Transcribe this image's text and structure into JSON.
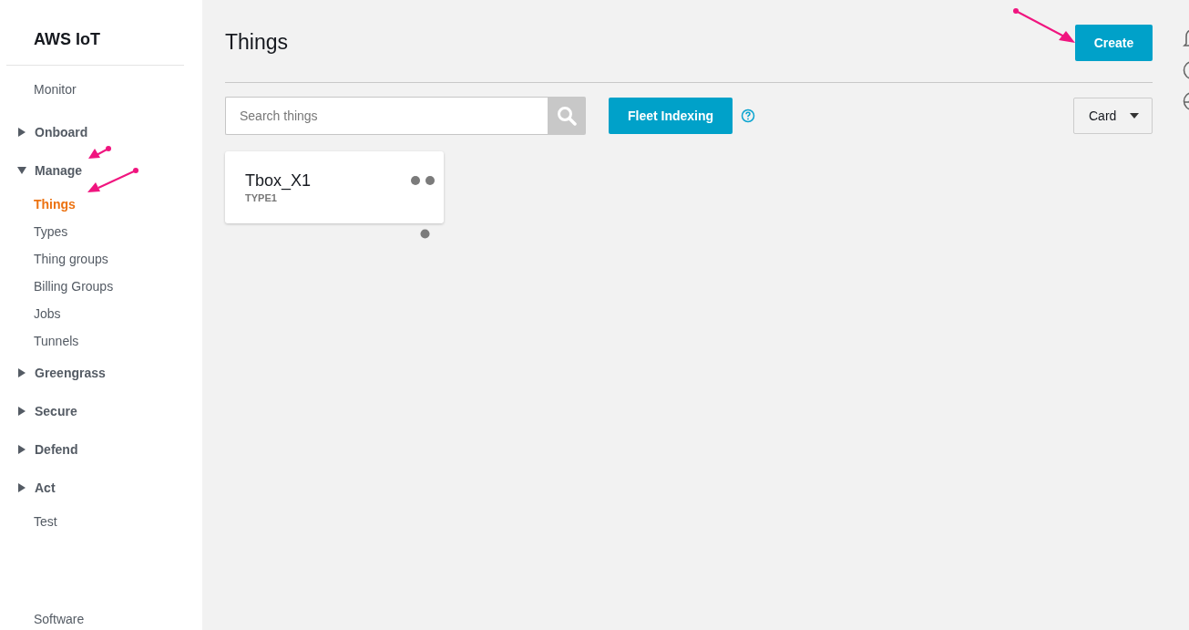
{
  "sidebar": {
    "title": "AWS IoT",
    "items": [
      {
        "kind": "link",
        "label": "Monitor",
        "selected": false
      },
      {
        "kind": "group",
        "label": "Onboard",
        "expanded": false
      },
      {
        "kind": "group",
        "label": "Manage",
        "expanded": true,
        "children": [
          {
            "label": "Things",
            "selected": true
          },
          {
            "label": "Types",
            "selected": false
          },
          {
            "label": "Thing groups",
            "selected": false
          },
          {
            "label": "Billing Groups",
            "selected": false
          },
          {
            "label": "Jobs",
            "selected": false
          },
          {
            "label": "Tunnels",
            "selected": false
          }
        ]
      },
      {
        "kind": "group",
        "label": "Greengrass",
        "expanded": false
      },
      {
        "kind": "group",
        "label": "Secure",
        "expanded": false
      },
      {
        "kind": "group",
        "label": "Defend",
        "expanded": false
      },
      {
        "kind": "group",
        "label": "Act",
        "expanded": false
      },
      {
        "kind": "link",
        "label": "Test",
        "selected": false
      }
    ],
    "footer": "Software"
  },
  "page": {
    "title": "Things",
    "create_button": "Create"
  },
  "toolbar": {
    "search": {
      "placeholder": "Search things"
    },
    "fleet_button": "Fleet Indexing",
    "view_select": "Card"
  },
  "cards": [
    {
      "name": "Tbox_X1",
      "type": "TYPE1"
    }
  ]
}
